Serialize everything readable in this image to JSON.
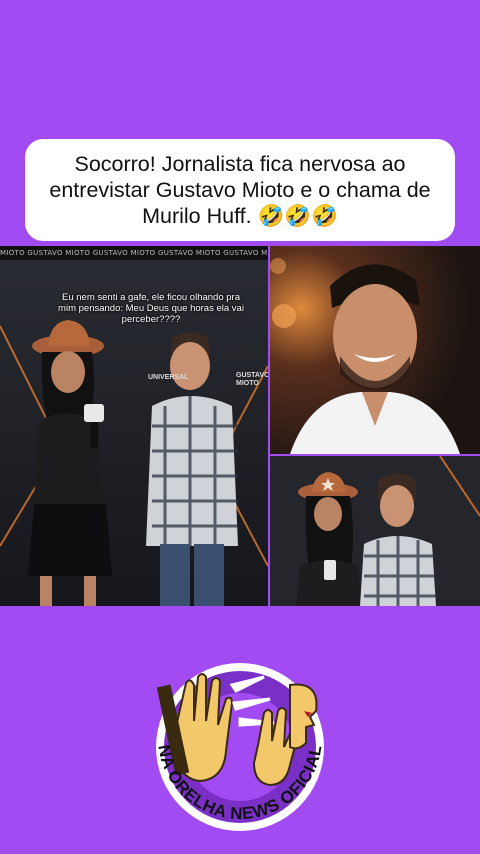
{
  "headline": {
    "text": "Socorro! Jornalista fica nervosa ao entrevistar Gustavo Mioto e o chama de Murilo Huff. 🤣🤣🤣"
  },
  "left_photo": {
    "backdrop_text": "MIOTO  GUSTAVO MIOTO   GUSTAVO MIOTO   GUSTAVO MIOTO   GUSTAVO MIOTO",
    "caption": "Eu nem senti a gafe, ele ficou olhando pra mim pensando: Meu Deus que horas ela vai perceber????",
    "sign_universal": "UNIVERSAL",
    "sign_gustavo_mioto": "GUSTAVO MIOTO"
  },
  "logo": {
    "text": "NA ORELHA NEWS OFICIAL"
  },
  "colors": {
    "background": "#a24bf3",
    "card": "#ffffff",
    "logo_ring": "#ffffff",
    "logo_inner": "#7a2fc7"
  }
}
